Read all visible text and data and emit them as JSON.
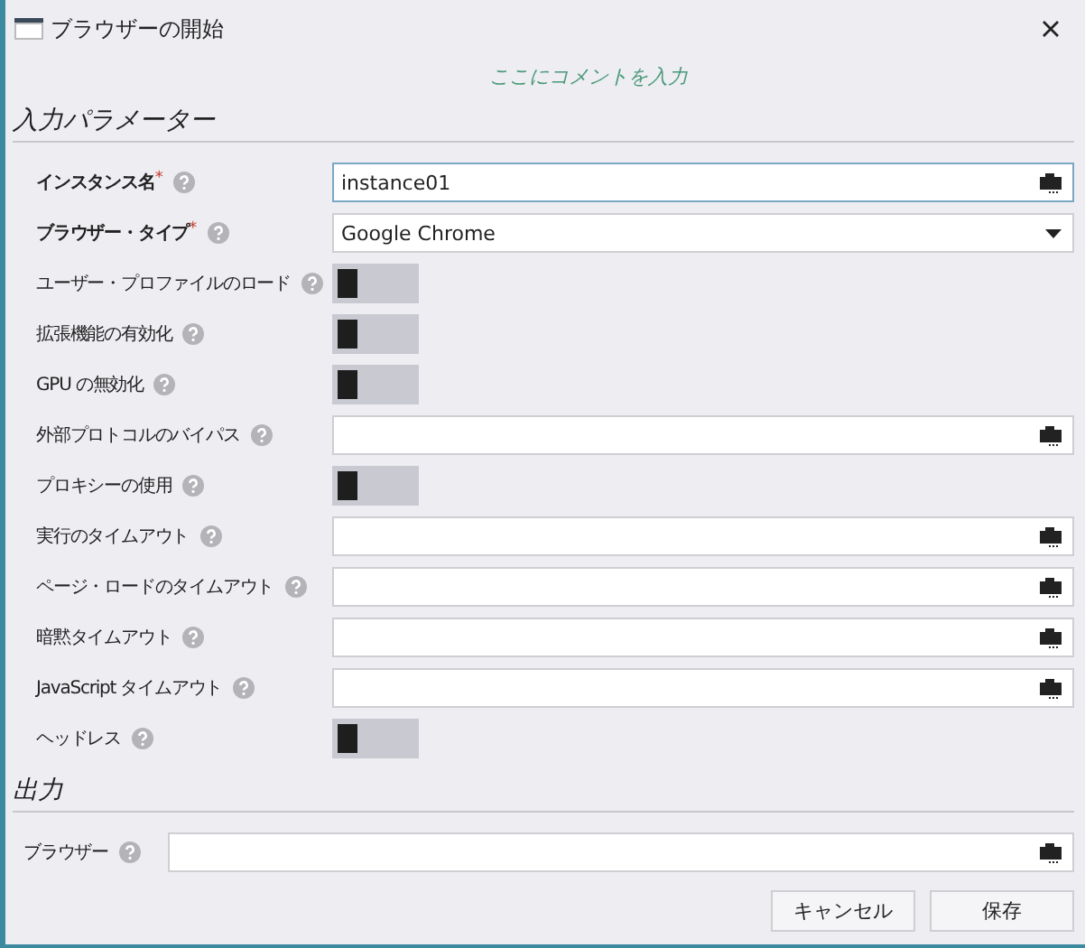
{
  "window": {
    "title": "ブラウザーの開始"
  },
  "required_mark": "*",
  "comment": {
    "placeholder": "ここにコメントを入力"
  },
  "input_section": {
    "heading": "入力パラメーター",
    "fields": [
      {
        "label": "インスタンス名",
        "required": true,
        "kind": "text",
        "value": "instance01",
        "focused": true
      },
      {
        "label": "ブラウザー・タイプ",
        "required": true,
        "kind": "dropdown",
        "value": "Google Chrome"
      },
      {
        "label": "ユーザー・プロファイルのロード",
        "required": false,
        "kind": "toggle",
        "on": false
      },
      {
        "label": "拡張機能の有効化",
        "required": false,
        "kind": "toggle",
        "on": false
      },
      {
        "label": "GPU の無効化",
        "required": false,
        "kind": "toggle",
        "on": false
      },
      {
        "label": "外部プロトコルのバイパス",
        "required": false,
        "kind": "text"
      },
      {
        "label": "プロキシーの使用",
        "required": false,
        "kind": "toggle",
        "on": false
      },
      {
        "label": "実行のタイムアウト",
        "required": false,
        "kind": "text"
      },
      {
        "label": "ページ・ロードのタイムアウト",
        "required": false,
        "kind": "text"
      },
      {
        "label": "暗黙タイムアウト",
        "required": false,
        "kind": "text"
      },
      {
        "label": "JavaScript タイムアウト",
        "required": false,
        "kind": "text"
      },
      {
        "label": "ヘッドレス",
        "required": false,
        "kind": "toggle",
        "on": false
      }
    ]
  },
  "output_section": {
    "heading": "出力",
    "fields": [
      {
        "label": "ブラウザー",
        "kind": "text"
      }
    ]
  },
  "buttons": [
    {
      "label": "キャンセル"
    },
    {
      "label": "保存"
    }
  ]
}
